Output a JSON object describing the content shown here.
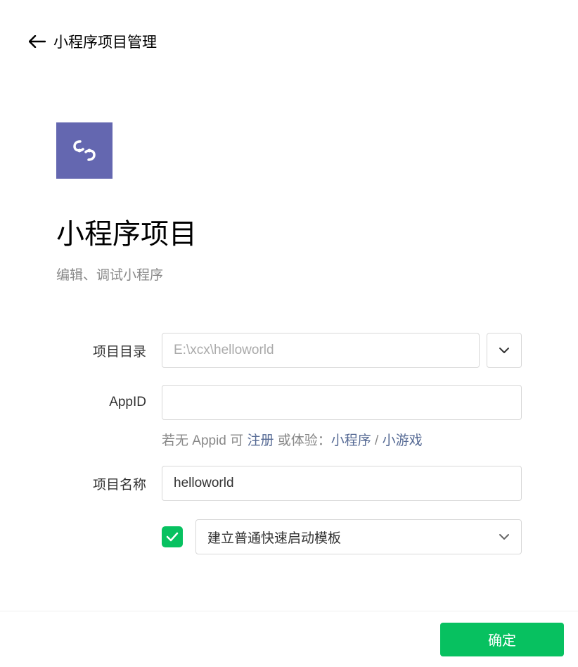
{
  "header": {
    "title": "小程序项目管理"
  },
  "page": {
    "title": "小程序项目",
    "subtitle": "编辑、调试小程序"
  },
  "form": {
    "project_dir": {
      "label": "项目目录",
      "placeholder": "E:\\xcx\\helloworld",
      "value": ""
    },
    "app_id": {
      "label": "AppID",
      "value": ""
    },
    "hint": {
      "prefix": "若无 Appid 可 ",
      "register": "注册",
      "middle": " 或体验：",
      "miniprogram": "小程序",
      "separator": " / ",
      "minigame": "小游戏"
    },
    "project_name": {
      "label": "项目名称",
      "value": "helloworld"
    },
    "template": {
      "checked": true,
      "selected": "建立普通快速启动模板"
    }
  },
  "footer": {
    "confirm": "确定"
  },
  "colors": {
    "accent": "#07c160",
    "icon_bg": "#6467b0",
    "link": "#576b95"
  }
}
